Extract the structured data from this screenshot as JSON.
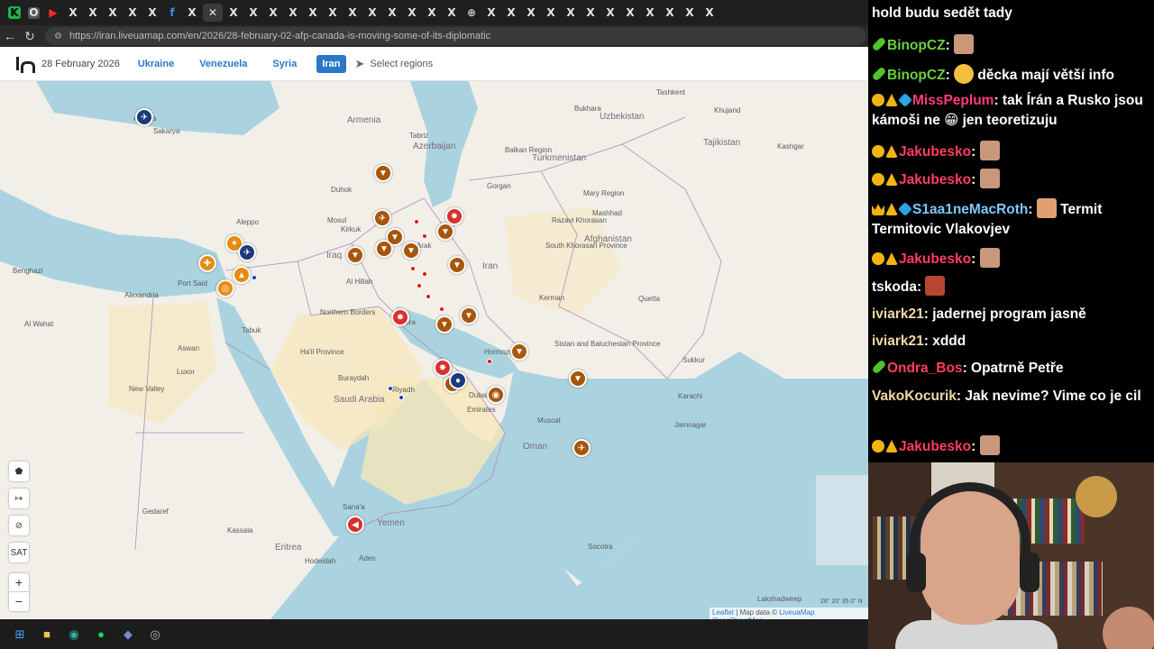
{
  "browser": {
    "url": "https://iran.liveuamap.com/en/2026/28-february-02-afp-canada-is-moving-some-of-its-diplomatic",
    "tab_marks": [
      "K",
      "O",
      "▶",
      "X",
      "X",
      "X",
      "X",
      "X",
      "f",
      "X",
      "✕",
      "X",
      "X",
      "X",
      "X",
      "X",
      "X",
      "X",
      "X",
      "X",
      "X",
      "X",
      "X",
      "⊕",
      "X",
      "X",
      "X",
      "X",
      "X",
      "X",
      "X",
      "X",
      "X",
      "X",
      "X",
      "X"
    ]
  },
  "site": {
    "date": "28 February 2026",
    "regions": [
      "Ukraine",
      "Venezuela",
      "Syria",
      "Iran"
    ],
    "active_region": "Iran",
    "select_regions": "Select regions"
  },
  "map": {
    "places": [
      {
        "name": "Sakarya",
        "type": "city"
      },
      {
        "name": "Ankara",
        "type": "city"
      },
      {
        "name": "Benghazi",
        "type": "city"
      },
      {
        "name": "Port Said",
        "type": "city"
      },
      {
        "name": "Alexandria",
        "type": "city"
      },
      {
        "name": "Al Wahat",
        "type": "city"
      },
      {
        "name": "Aswan",
        "type": "city"
      },
      {
        "name": "New Valley",
        "type": "city"
      },
      {
        "name": "Luxor",
        "type": "city"
      },
      {
        "name": "Tabuk",
        "type": "city"
      },
      {
        "name": "Al Hillah",
        "type": "city"
      },
      {
        "name": "Basra",
        "type": "city"
      },
      {
        "name": "Northern Borders",
        "type": "city"
      },
      {
        "name": "Ha'il Province",
        "type": "city"
      },
      {
        "name": "Buraydah",
        "type": "city"
      },
      {
        "name": "Riyadh",
        "type": "city"
      },
      {
        "name": "Saudi Arabia",
        "type": "country"
      },
      {
        "name": "Iraq",
        "type": "country"
      },
      {
        "name": "Iran",
        "type": "country"
      },
      {
        "name": "Kerman",
        "type": "city"
      },
      {
        "name": "Hormozgan",
        "type": "city"
      },
      {
        "name": "Sistan and Baluchestan Province",
        "type": "city"
      },
      {
        "name": "Afghanistan",
        "type": "country"
      },
      {
        "name": "Quetta",
        "type": "city"
      },
      {
        "name": "Sukkur",
        "type": "city"
      },
      {
        "name": "Karachi",
        "type": "city"
      },
      {
        "name": "Jamnagar",
        "type": "city"
      },
      {
        "name": "Muscat",
        "type": "city"
      },
      {
        "name": "Oman",
        "type": "country"
      },
      {
        "name": "Emirates",
        "type": "city"
      },
      {
        "name": "Dubai",
        "type": "city"
      },
      {
        "name": "Yemen",
        "type": "country"
      },
      {
        "name": "Sana'a",
        "type": "city"
      },
      {
        "name": "Aden",
        "type": "city"
      },
      {
        "name": "Eritrea",
        "type": "country"
      },
      {
        "name": "Gedaref",
        "type": "city"
      },
      {
        "name": "Kassala",
        "type": "city"
      },
      {
        "name": "Azerbaijan",
        "type": "country"
      },
      {
        "name": "Armenia",
        "type": "country"
      },
      {
        "name": "Turkmenistan",
        "type": "country"
      },
      {
        "name": "Uzbekistan",
        "type": "country"
      },
      {
        "name": "Tajikistan",
        "type": "country"
      },
      {
        "name": "Kashgar",
        "type": "city"
      },
      {
        "name": "Khujand",
        "type": "city"
      },
      {
        "name": "Tashkent",
        "type": "city"
      },
      {
        "name": "Bukhara",
        "type": "city"
      },
      {
        "name": "Balkan Region",
        "type": "city"
      },
      {
        "name": "Mary Region",
        "type": "city"
      },
      {
        "name": "Razavi Khorasan",
        "type": "city"
      },
      {
        "name": "South Khorasan Province",
        "type": "city"
      },
      {
        "name": "Tabriz",
        "type": "city"
      },
      {
        "name": "Kirkuk",
        "type": "city"
      },
      {
        "name": "Mosul",
        "type": "city"
      },
      {
        "name": "Aleppo",
        "type": "city"
      },
      {
        "name": "Duhok",
        "type": "city"
      },
      {
        "name": "Arak",
        "type": "city"
      },
      {
        "name": "Mashhad",
        "type": "city"
      },
      {
        "name": "Gorgan",
        "type": "city"
      },
      {
        "name": "Lakshadweep",
        "type": "city"
      },
      {
        "name": "Hodeidah",
        "type": "city"
      },
      {
        "name": "Socotra",
        "type": "city"
      }
    ],
    "coords_readout": "28° 20' 35.0\" N",
    "attribution": {
      "leaflet": "Leaflet",
      "text": "| Map data ©",
      "provider": "LiveuaMap OpenStreetMap"
    },
    "controls": {
      "sat": "SAT",
      "zoom_in": "+",
      "zoom_out": "−"
    }
  },
  "chat": {
    "messages": [
      {
        "user": "",
        "user_color": "#ffffff",
        "text": "hold budu sedět tady",
        "badges": [],
        "emote": ""
      },
      {
        "user": "BinopCZ",
        "user_color": "#6ccf3a",
        "text": "",
        "badges": [
          "pill"
        ],
        "emote": "face"
      },
      {
        "user": "BinopCZ",
        "user_color": "#6ccf3a",
        "text": "děcka mají větší info",
        "badges": [
          "pill"
        ],
        "emote": "laugh"
      },
      {
        "user": "MissPeplum",
        "user_color": "#ff3b7a",
        "text": "tak Írán a Rusko jsou kámoši ne 😁 jen teoretizuju",
        "badges": [
          "coin",
          "wolf",
          "gem"
        ],
        "emote": ""
      },
      {
        "user": "Jakubesko",
        "user_color": "#ff3d62",
        "text": "",
        "badges": [
          "coin",
          "wolf"
        ],
        "emote": "face"
      },
      {
        "user": "Jakubesko",
        "user_color": "#ff3d62",
        "text": "",
        "badges": [
          "coin",
          "wolf"
        ],
        "emote": "face"
      },
      {
        "user": "S1aa1neMacRoth",
        "user_color": "#7dc8ff",
        "text": "Termit Termitovic Vlakovjev",
        "badges": [
          "crown",
          "wolf",
          "gem"
        ],
        "emote": "grin"
      },
      {
        "user": "Jakubesko",
        "user_color": "#ff3d62",
        "text": "",
        "badges": [
          "coin",
          "wolf"
        ],
        "emote": "face"
      },
      {
        "user": "tskoda",
        "user_color": "#ffffff",
        "text": "",
        "badges": [],
        "emote": "red"
      },
      {
        "user": "iviark21",
        "user_color": "#f0d7a8",
        "text": "jadernej program jasně",
        "badges": [],
        "emote": ""
      },
      {
        "user": "iviark21",
        "user_color": "#f0d7a8",
        "text": "xddd",
        "badges": [],
        "emote": ""
      },
      {
        "user": "Ondra_Bos",
        "user_color": "#ff3d62",
        "text": "Opatrně Petře",
        "badges": [
          "pill"
        ],
        "emote": ""
      },
      {
        "user": "VakoKocurik",
        "user_color": "#f0d7a8",
        "text": "Jak nevime? Vime co je cil",
        "badges": [],
        "emote": ""
      },
      {
        "user": "Jakubesko",
        "user_color": "#ff3d62",
        "text": "",
        "badges": [
          "coin",
          "wolf"
        ],
        "emote": "face"
      }
    ]
  },
  "colors": {
    "sea": "#aad3df",
    "land": "#f2efe9",
    "desert": "#f6e7b9",
    "marker_brown": "#a8560c",
    "accent": "#2a78c8"
  }
}
